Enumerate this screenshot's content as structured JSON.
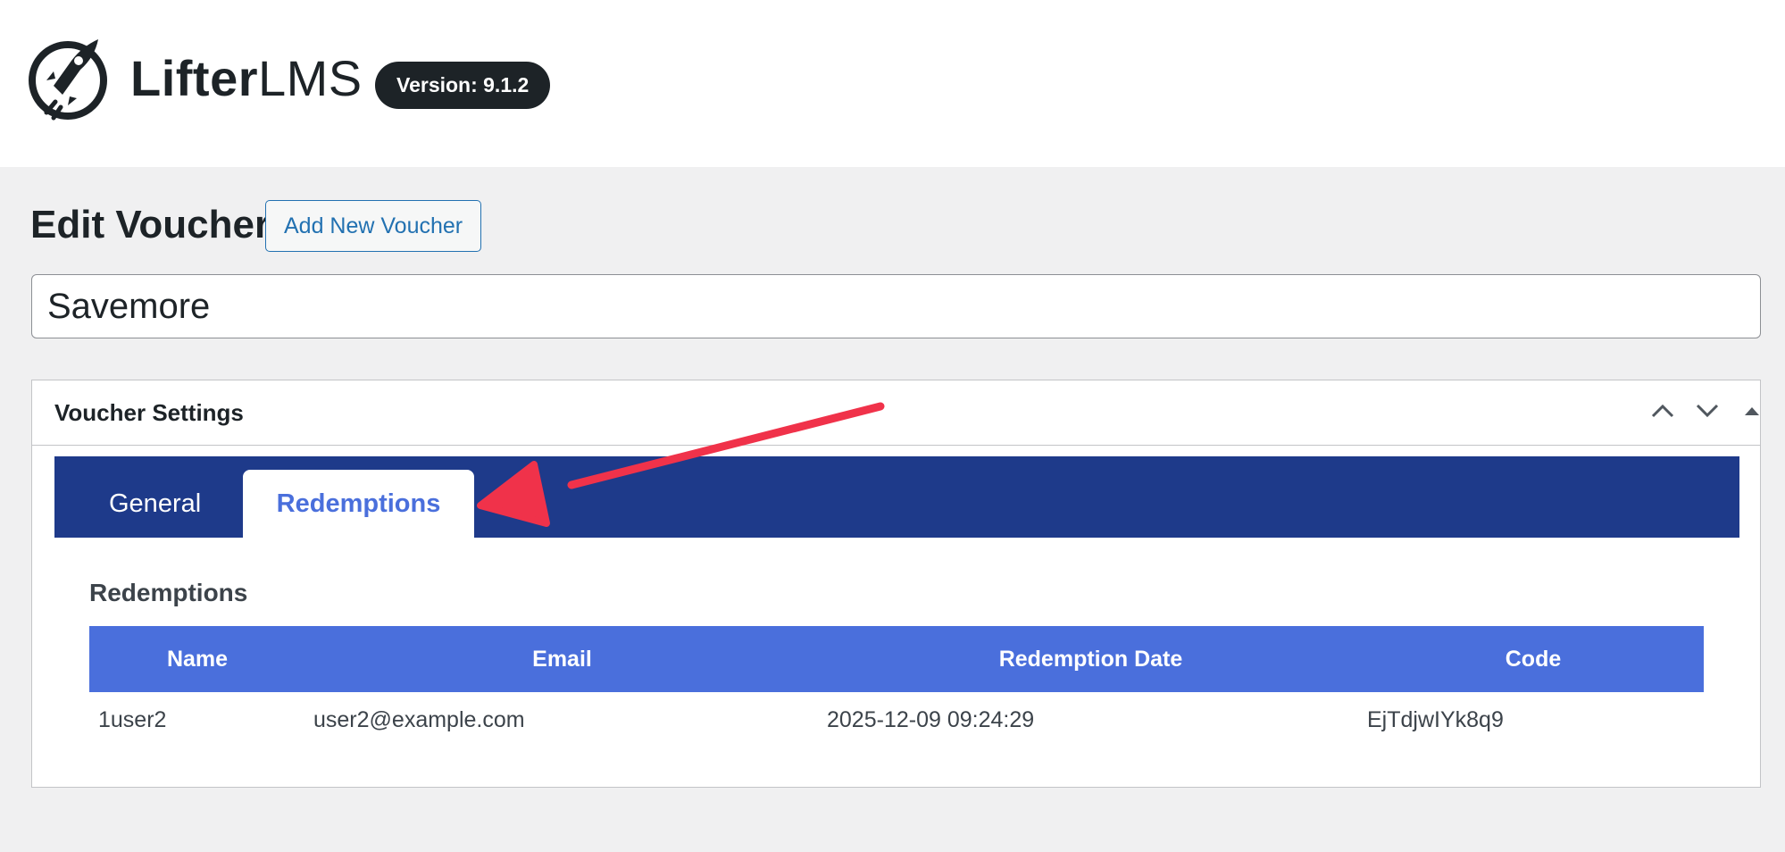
{
  "brand": {
    "name_bold": "Lifter",
    "name_light": "LMS",
    "version_badge": "Version: 9.1.2"
  },
  "page": {
    "title": "Edit Voucher",
    "add_new_label": "Add New Voucher",
    "voucher_title_value": "Savemore"
  },
  "metabox": {
    "title": "Voucher Settings",
    "tabs": [
      {
        "label": "General",
        "active": false
      },
      {
        "label": "Redemptions",
        "active": true
      }
    ],
    "section_heading": "Redemptions",
    "table": {
      "columns": [
        "Name",
        "Email",
        "Redemption Date",
        "Code"
      ],
      "rows": [
        {
          "name": "1user2",
          "email": "user2@example.com",
          "date": "2025-12-09 09:24:29",
          "code": "EjTdjwIYk8q9"
        }
      ]
    }
  },
  "colors": {
    "tab_bar": "#1e3a8a",
    "table_header": "#4a6fdc",
    "active_tab_text": "#4a6fdc",
    "link_blue": "#2271b1",
    "annotation_arrow": "#f0324a"
  },
  "icons": [
    "rocket-logo-icon",
    "chevron-up-icon",
    "chevron-down-icon",
    "triangle-up-icon",
    "annotation-arrow"
  ]
}
